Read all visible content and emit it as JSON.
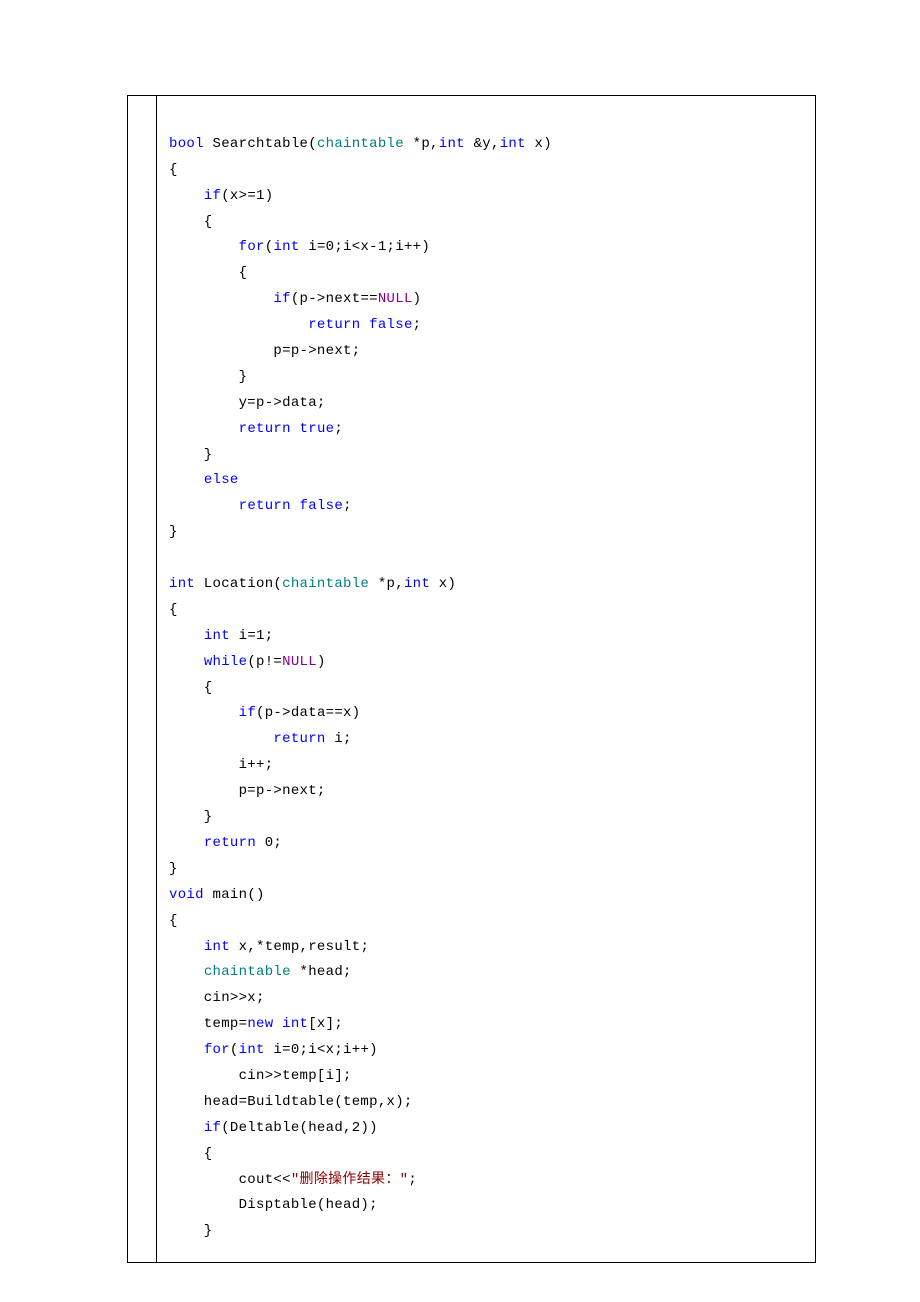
{
  "code": {
    "tokens": [
      {
        "t": "\n",
        "c": "plain"
      },
      {
        "t": "bool",
        "c": "kw"
      },
      {
        "t": " Searchtable(",
        "c": "plain"
      },
      {
        "t": "chaintable",
        "c": "type"
      },
      {
        "t": " *p,",
        "c": "plain"
      },
      {
        "t": "int",
        "c": "kw"
      },
      {
        "t": " &y,",
        "c": "plain"
      },
      {
        "t": "int",
        "c": "kw"
      },
      {
        "t": " x)\n",
        "c": "plain"
      },
      {
        "t": "{\n",
        "c": "plain"
      },
      {
        "t": "    ",
        "c": "plain"
      },
      {
        "t": "if",
        "c": "kw"
      },
      {
        "t": "(x>=1)\n",
        "c": "plain"
      },
      {
        "t": "    {\n",
        "c": "plain"
      },
      {
        "t": "        ",
        "c": "plain"
      },
      {
        "t": "for",
        "c": "kw"
      },
      {
        "t": "(",
        "c": "plain"
      },
      {
        "t": "int",
        "c": "kw"
      },
      {
        "t": " i=0;i<x-1;i++)\n",
        "c": "plain"
      },
      {
        "t": "        {\n",
        "c": "plain"
      },
      {
        "t": "            ",
        "c": "plain"
      },
      {
        "t": "if",
        "c": "kw"
      },
      {
        "t": "(p->next==",
        "c": "plain"
      },
      {
        "t": "NULL",
        "c": "null"
      },
      {
        "t": ")\n",
        "c": "plain"
      },
      {
        "t": "                ",
        "c": "plain"
      },
      {
        "t": "return",
        "c": "kw"
      },
      {
        "t": " ",
        "c": "plain"
      },
      {
        "t": "false",
        "c": "kw"
      },
      {
        "t": ";\n",
        "c": "plain"
      },
      {
        "t": "            p=p->next;\n",
        "c": "plain"
      },
      {
        "t": "        }\n",
        "c": "plain"
      },
      {
        "t": "        y=p->data;\n",
        "c": "plain"
      },
      {
        "t": "        ",
        "c": "plain"
      },
      {
        "t": "return",
        "c": "kw"
      },
      {
        "t": " ",
        "c": "plain"
      },
      {
        "t": "true",
        "c": "kw"
      },
      {
        "t": ";\n",
        "c": "plain"
      },
      {
        "t": "    }\n",
        "c": "plain"
      },
      {
        "t": "    ",
        "c": "plain"
      },
      {
        "t": "else",
        "c": "kw"
      },
      {
        "t": "\n",
        "c": "plain"
      },
      {
        "t": "        ",
        "c": "plain"
      },
      {
        "t": "return",
        "c": "kw"
      },
      {
        "t": " ",
        "c": "plain"
      },
      {
        "t": "false",
        "c": "kw"
      },
      {
        "t": ";\n",
        "c": "plain"
      },
      {
        "t": "}\n",
        "c": "plain"
      },
      {
        "t": "\n",
        "c": "plain"
      },
      {
        "t": "int",
        "c": "kw"
      },
      {
        "t": " Location(",
        "c": "plain"
      },
      {
        "t": "chaintable",
        "c": "type"
      },
      {
        "t": " *p,",
        "c": "plain"
      },
      {
        "t": "int",
        "c": "kw"
      },
      {
        "t": " x)\n",
        "c": "plain"
      },
      {
        "t": "{\n",
        "c": "plain"
      },
      {
        "t": "    ",
        "c": "plain"
      },
      {
        "t": "int",
        "c": "kw"
      },
      {
        "t": " i=1;\n",
        "c": "plain"
      },
      {
        "t": "    ",
        "c": "plain"
      },
      {
        "t": "while",
        "c": "kw"
      },
      {
        "t": "(p!=",
        "c": "plain"
      },
      {
        "t": "NULL",
        "c": "null"
      },
      {
        "t": ")\n",
        "c": "plain"
      },
      {
        "t": "    {\n",
        "c": "plain"
      },
      {
        "t": "        ",
        "c": "plain"
      },
      {
        "t": "if",
        "c": "kw"
      },
      {
        "t": "(p->data==x)\n",
        "c": "plain"
      },
      {
        "t": "            ",
        "c": "plain"
      },
      {
        "t": "return",
        "c": "kw"
      },
      {
        "t": " i;\n",
        "c": "plain"
      },
      {
        "t": "        i++;\n",
        "c": "plain"
      },
      {
        "t": "        p=p->next;\n",
        "c": "plain"
      },
      {
        "t": "    }\n",
        "c": "plain"
      },
      {
        "t": "    ",
        "c": "plain"
      },
      {
        "t": "return",
        "c": "kw"
      },
      {
        "t": " 0;\n",
        "c": "plain"
      },
      {
        "t": "}\n",
        "c": "plain"
      },
      {
        "t": "void",
        "c": "kw"
      },
      {
        "t": " main()\n",
        "c": "plain"
      },
      {
        "t": "{\n",
        "c": "plain"
      },
      {
        "t": "    ",
        "c": "plain"
      },
      {
        "t": "int",
        "c": "kw"
      },
      {
        "t": " x,*temp,result;\n",
        "c": "plain"
      },
      {
        "t": "    ",
        "c": "plain"
      },
      {
        "t": "chaintable",
        "c": "type"
      },
      {
        "t": " *head;\n",
        "c": "plain"
      },
      {
        "t": "    cin>>x;\n",
        "c": "plain"
      },
      {
        "t": "    temp=",
        "c": "plain"
      },
      {
        "t": "new",
        "c": "kw"
      },
      {
        "t": " ",
        "c": "plain"
      },
      {
        "t": "int",
        "c": "kw"
      },
      {
        "t": "[x];\n",
        "c": "plain"
      },
      {
        "t": "    ",
        "c": "plain"
      },
      {
        "t": "for",
        "c": "kw"
      },
      {
        "t": "(",
        "c": "plain"
      },
      {
        "t": "int",
        "c": "kw"
      },
      {
        "t": " i=0;i<x;i++)\n",
        "c": "plain"
      },
      {
        "t": "        cin>>temp[i];\n",
        "c": "plain"
      },
      {
        "t": "    head=Buildtable(temp,x);\n",
        "c": "plain"
      },
      {
        "t": "    ",
        "c": "plain"
      },
      {
        "t": "if",
        "c": "kw"
      },
      {
        "t": "(Deltable(head,2))\n",
        "c": "plain"
      },
      {
        "t": "    {\n",
        "c": "plain"
      },
      {
        "t": "        cout<<",
        "c": "plain"
      },
      {
        "t": "\"删除操作结果：\"",
        "c": "str"
      },
      {
        "t": ";\n",
        "c": "plain"
      },
      {
        "t": "        Disptable(head);\n",
        "c": "plain"
      },
      {
        "t": "    }",
        "c": "plain"
      }
    ]
  }
}
